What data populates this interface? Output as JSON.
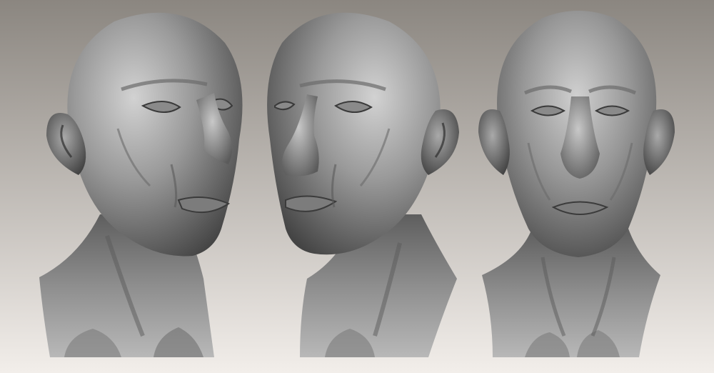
{
  "scene": {
    "background_top": "#8b8680",
    "background_bottom": "#f2eeea",
    "clay_light": "#cfcfcf",
    "clay_mid": "#8f8f8f",
    "clay_dark": "#3e3e3e"
  },
  "views": [
    {
      "view": "three-quarter-right"
    },
    {
      "view": "three-quarter-left"
    },
    {
      "view": "front"
    }
  ]
}
